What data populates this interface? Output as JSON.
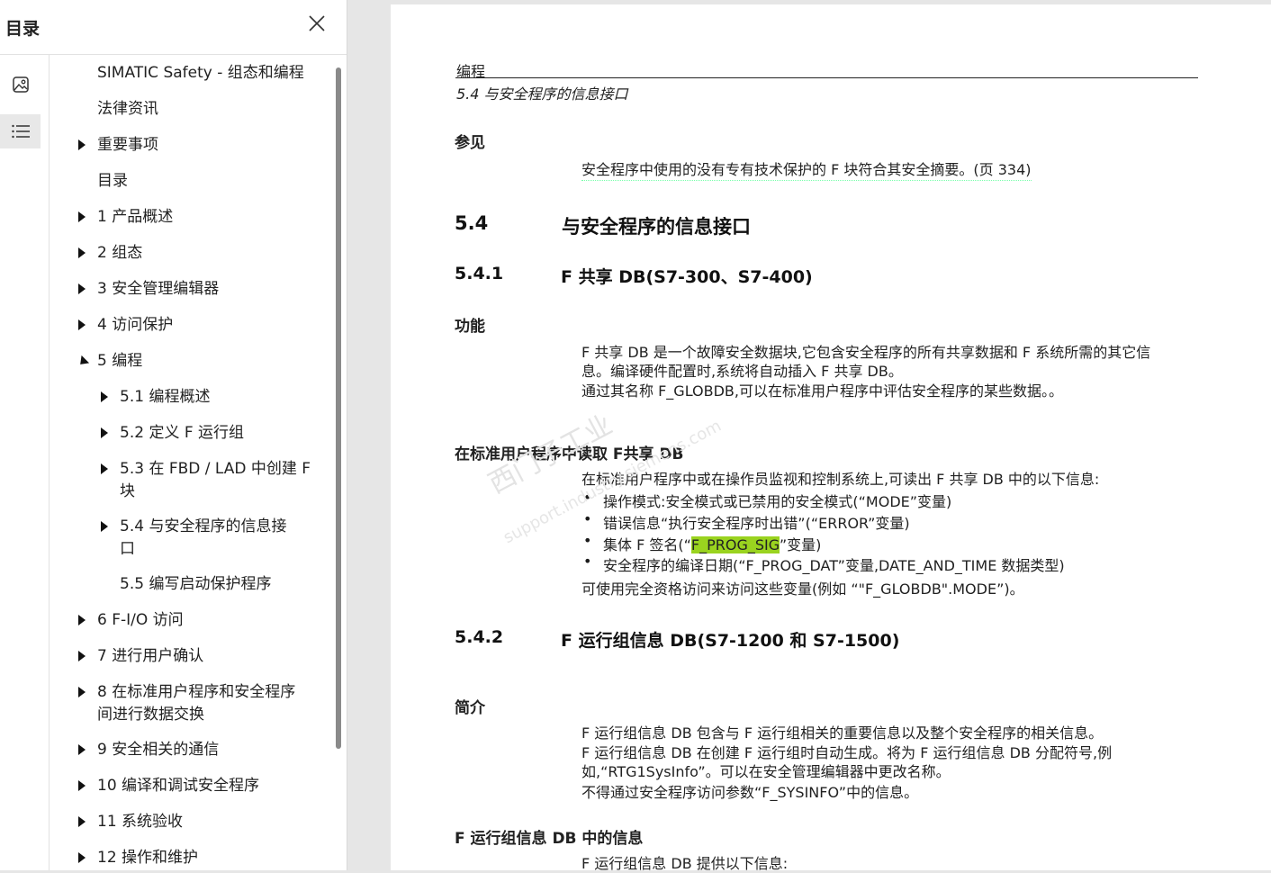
{
  "sidebar": {
    "title": "目录",
    "toc": [
      {
        "label": "SIMATIC Safety - 组态和编程",
        "arrow": "none",
        "level": 0
      },
      {
        "label": "法律资讯",
        "arrow": "none",
        "level": 0
      },
      {
        "label": "重要事项",
        "arrow": "right",
        "level": 0
      },
      {
        "label": "目录",
        "arrow": "none",
        "level": 0
      },
      {
        "label": "1 产品概述",
        "arrow": "right",
        "level": 0
      },
      {
        "label": "2 组态",
        "arrow": "right",
        "level": 0
      },
      {
        "label": "3 安全管理编辑器",
        "arrow": "right",
        "level": 0
      },
      {
        "label": "4 访问保护",
        "arrow": "right",
        "level": 0
      },
      {
        "label": "5 编程",
        "arrow": "down",
        "level": 0
      },
      {
        "label": "5.1 编程概述",
        "arrow": "right",
        "level": 1
      },
      {
        "label": "5.2 定义 F 运行组",
        "arrow": "right",
        "level": 1
      },
      {
        "label": "5.3 在 FBD / LAD 中创建 F",
        "label2": "块",
        "arrow": "right",
        "level": 1
      },
      {
        "label": "5.4 与安全程序的信息接",
        "label2": "口",
        "arrow": "right",
        "level": 1
      },
      {
        "label": "5.5 编写启动保护程序",
        "arrow": "none",
        "level": 1
      },
      {
        "label": "6 F-I/O 访问",
        "arrow": "right",
        "level": 0
      },
      {
        "label": "7 进行用户确认",
        "arrow": "right",
        "level": 0
      },
      {
        "label": "8 在标准用户程序和安全程序",
        "label2": "间进行数据交换",
        "arrow": "right",
        "level": 0
      },
      {
        "label": "9 安全相关的通信",
        "arrow": "right",
        "level": 0
      },
      {
        "label": "10 编译和调试安全程序",
        "arrow": "right",
        "level": 0
      },
      {
        "label": "11 系统验收",
        "arrow": "right",
        "level": 0
      },
      {
        "label": "12 操作和维护",
        "arrow": "right",
        "level": 0
      }
    ]
  },
  "doc": {
    "header_chapter": "编程",
    "header_section": "5.4 与安全程序的信息接口",
    "see_also_title": "参见",
    "see_also_link": "安全程序中使用的没有专有技术保护的 F 块符合其安全摘要。(页 334)",
    "s54_num": "5.4",
    "s54_title": "与安全程序的信息接口",
    "s541_num": "5.4.1",
    "s541_title": "F 共享 DB(S7-300、S7-400)",
    "func_title": "功能",
    "func_p1a": "F 共享 DB 是一个故障安全数据块,它包含安全程序的所有共享数据和 F 系统所需的其它信",
    "func_p1b": "息。编译硬件配置时,系统将自动插入 F 共享 DB。",
    "func_p2": "通过其名称 F_GLOBDB,可以在标准用户程序中评估安全程序的某些数据。。",
    "read_title": "在标准用户程序中读取 F共享 DB",
    "read_intro": "在标准用户程序中或在操作员监视和控制系统上,可读出 F 共享 DB 中的以下信息:",
    "b1": "操作模式:安全模式或已禁用的安全模式(“MODE”变量)",
    "b2": "错误信息“执行安全程序时出错”(“ERROR”变量)",
    "b3_pre": "集体 F 签名(“",
    "b3_hl": "F_PROG_SIG",
    "b3_post": "”变量)",
    "b4": "安全程序的编译日期(“F_PROG_DAT”变量,DATE_AND_TIME 数据类型)",
    "read_outro": "可使用完全资格访问来访问这些变量(例如 “\"F_GLOBDB\".MODE”)。",
    "s542_num": "5.4.2",
    "s542_title": "F 运行组信息 DB(S7-1200 和 S7-1500)",
    "intro_title": "简介",
    "intro_p1": "F 运行组信息 DB 包含与 F 运行组相关的重要信息以及整个安全程序的相关信息。",
    "intro_p2a": "F 运行组信息 DB 在创建 F 运行组时自动生成。将为 F 运行组信息 DB 分配符号,例",
    "intro_p2b": "如,“RTG1SysInfo”。可以在安全管理编辑器中更改名称。",
    "intro_p3": "不得通过安全程序访问参数“F_SYSINFO”中的信息。",
    "info_title": "F 运行组信息 DB 中的信息",
    "info_p1": "F 运行组信息 DB 提供以下信息:",
    "watermark": "西门子工业",
    "watermark2": "support.industry.siemens.com"
  },
  "colors": {
    "highlight": "#9ad31f",
    "rule": "#222222"
  }
}
